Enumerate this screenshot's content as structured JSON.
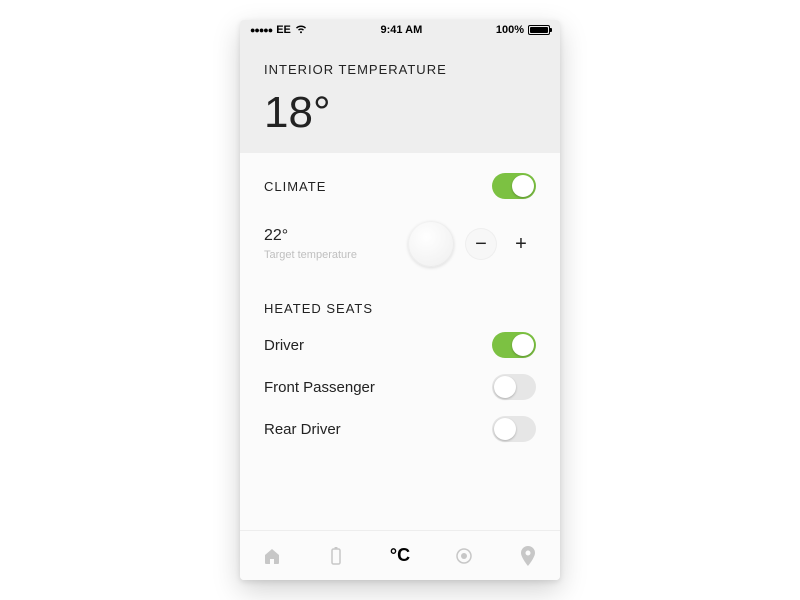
{
  "status_bar": {
    "carrier": "EE",
    "time": "9:41 AM",
    "battery_pct": "100%"
  },
  "header": {
    "label": "INTERIOR TEMPERATURE",
    "value": "18°"
  },
  "climate": {
    "title": "CLIMATE",
    "on": true,
    "target_value": "22°",
    "target_caption": "Target temperature",
    "minus": "−",
    "plus": "+"
  },
  "heated_seats": {
    "title": "HEATED SEATS",
    "rows": [
      {
        "label": "Driver",
        "on": true
      },
      {
        "label": "Front Passenger",
        "on": false
      },
      {
        "label": "Rear Driver",
        "on": false
      }
    ]
  },
  "tabbar": {
    "items": [
      {
        "name": "home",
        "active": false
      },
      {
        "name": "battery",
        "active": false
      },
      {
        "name": "climate",
        "label": "°C",
        "active": true
      },
      {
        "name": "status",
        "active": false
      },
      {
        "name": "location",
        "active": false
      }
    ]
  },
  "colors": {
    "toggle_on": "#7cc142",
    "header_bg": "#eeeeee"
  }
}
